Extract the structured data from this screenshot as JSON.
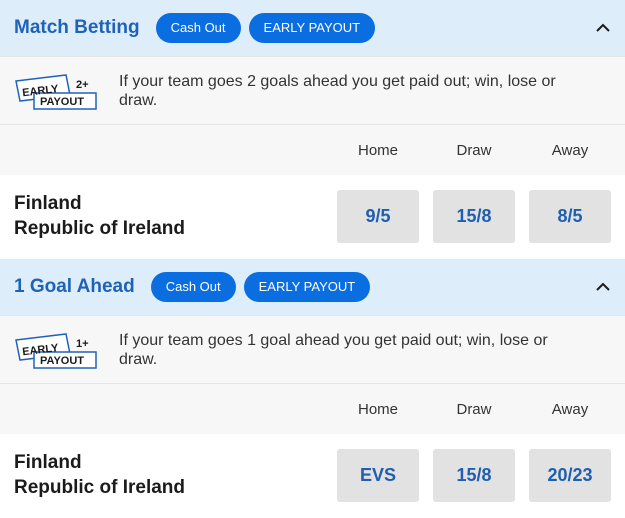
{
  "markets": [
    {
      "title": "Match Betting",
      "badges": [
        "Cash Out",
        "EARLY PAYOUT"
      ],
      "early_badge": {
        "line1": "EARLY",
        "goals": "2+",
        "line2": "PAYOUT"
      },
      "info": "If your team goes 2 goals ahead you get paid out; win, lose or draw.",
      "columns": [
        "Home",
        "Draw",
        "Away"
      ],
      "teams": [
        "Finland",
        "Republic of Ireland"
      ],
      "odds": [
        "9/5",
        "15/8",
        "8/5"
      ]
    },
    {
      "title": "1 Goal Ahead",
      "badges": [
        "Cash Out",
        "EARLY PAYOUT"
      ],
      "early_badge": {
        "line1": "EARLY",
        "goals": "1+",
        "line2": "PAYOUT"
      },
      "info": "If your team goes 1 goal ahead you get paid out; win, lose or draw.",
      "columns": [
        "Home",
        "Draw",
        "Away"
      ],
      "teams": [
        "Finland",
        "Republic of Ireland"
      ],
      "odds": [
        "EVS",
        "15/8",
        "20/23"
      ]
    }
  ],
  "colors": {
    "header_bg": "#deedfa",
    "accent": "#1f63b9",
    "pill": "#0a6ee0",
    "odds_bg": "#e2e2e2"
  },
  "icons": {
    "collapse": "chevron-up-icon"
  }
}
